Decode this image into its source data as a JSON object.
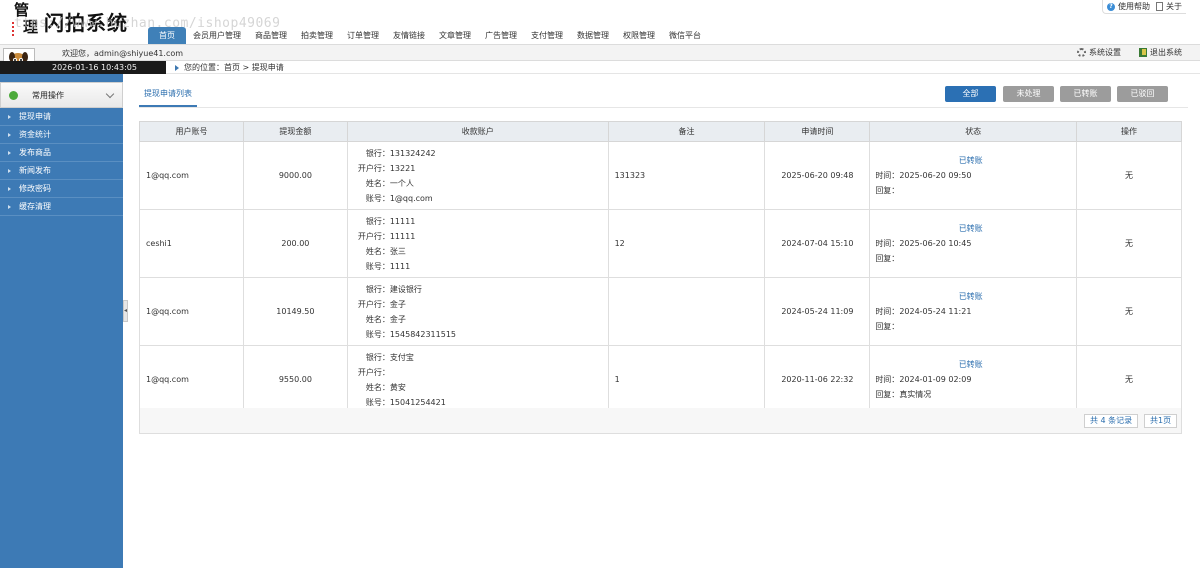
{
  "header": {
    "logo_char1": "管",
    "logo_char2": "理",
    "title": "闪拍系统",
    "watermark": "ttps://www.huzhan.com/ishop49069",
    "help_label": "使用帮助",
    "about_label": "关于"
  },
  "nav": {
    "items": [
      {
        "label": "首页"
      },
      {
        "label": "会员用户管理"
      },
      {
        "label": "商品管理"
      },
      {
        "label": "拍卖管理"
      },
      {
        "label": "订单管理"
      },
      {
        "label": "友情链接"
      },
      {
        "label": "文章管理"
      },
      {
        "label": "广告管理"
      },
      {
        "label": "支付管理"
      },
      {
        "label": "数据管理"
      },
      {
        "label": "权限管理"
      },
      {
        "label": "微信平台"
      }
    ]
  },
  "welcome": {
    "text": "欢迎您，admin@shiyue41.com",
    "settings_label": "系统设置",
    "logout_label": "退出系统"
  },
  "time": "2026-01-16 10:43:05",
  "breadcrumb": "您的位置：首页 > 提现申请",
  "sidebar": {
    "header": "常用操作",
    "items": [
      {
        "label": "提现申请"
      },
      {
        "label": "资金统计"
      },
      {
        "label": "发布商品"
      },
      {
        "label": "新闻发布"
      },
      {
        "label": "修改密码"
      },
      {
        "label": "缓存清理"
      }
    ]
  },
  "main": {
    "list_title": "提现申请列表",
    "filters": {
      "all": "全部",
      "pending": "未处理",
      "transferred": "已转账",
      "rejected": "已驳回"
    },
    "columns": {
      "user": "用户账号",
      "amount": "提现金额",
      "account": "收款账户",
      "remark": "备注",
      "apply_time": "申请时间",
      "status": "状态",
      "action": "操作"
    },
    "labels": {
      "bank": "银行：",
      "branch": "开户行：",
      "name": "姓名：",
      "number": "账号：",
      "time": "时间：",
      "reply": "回复："
    },
    "rows": [
      {
        "user": "1@qq.com",
        "amount": "9000.00",
        "bank": "131324242",
        "branch": "13221",
        "name": "一个人",
        "number": "1@qq.com",
        "remark": "131323",
        "apply_time": "2025-06-20 09:48",
        "status": "已转账",
        "status_time": "2025-06-20 09:50",
        "reply": "",
        "action": "无"
      },
      {
        "user": "ceshi1",
        "amount": "200.00",
        "bank": "11111",
        "branch": "11111",
        "name": "张三",
        "number": "1111",
        "remark": "12",
        "apply_time": "2024-07-04 15:10",
        "status": "已转账",
        "status_time": "2025-06-20 10:45",
        "reply": "",
        "action": "无"
      },
      {
        "user": "1@qq.com",
        "amount": "10149.50",
        "bank": "建设银行",
        "branch": "金子",
        "name": "金子",
        "number": "1545842311515",
        "remark": "",
        "apply_time": "2024-05-24 11:09",
        "status": "已转账",
        "status_time": "2024-05-24 11:21",
        "reply": "",
        "action": "无"
      },
      {
        "user": "1@qq.com",
        "amount": "9550.00",
        "bank": "支付宝",
        "branch": "",
        "name": "黄安",
        "number": "15041254421",
        "remark": "1",
        "apply_time": "2020-11-06 22:32",
        "status": "已转账",
        "status_time": "2024-01-09 02:09",
        "reply": "真实情况",
        "action": "无"
      }
    ],
    "pager": {
      "total": "共 4 条记录",
      "pages": "共1页"
    }
  },
  "colors": {
    "accent": "#3d7ab5",
    "link": "#2b6eae",
    "primary_button": "#2b70b4",
    "muted_button": "#9c9c9c"
  }
}
